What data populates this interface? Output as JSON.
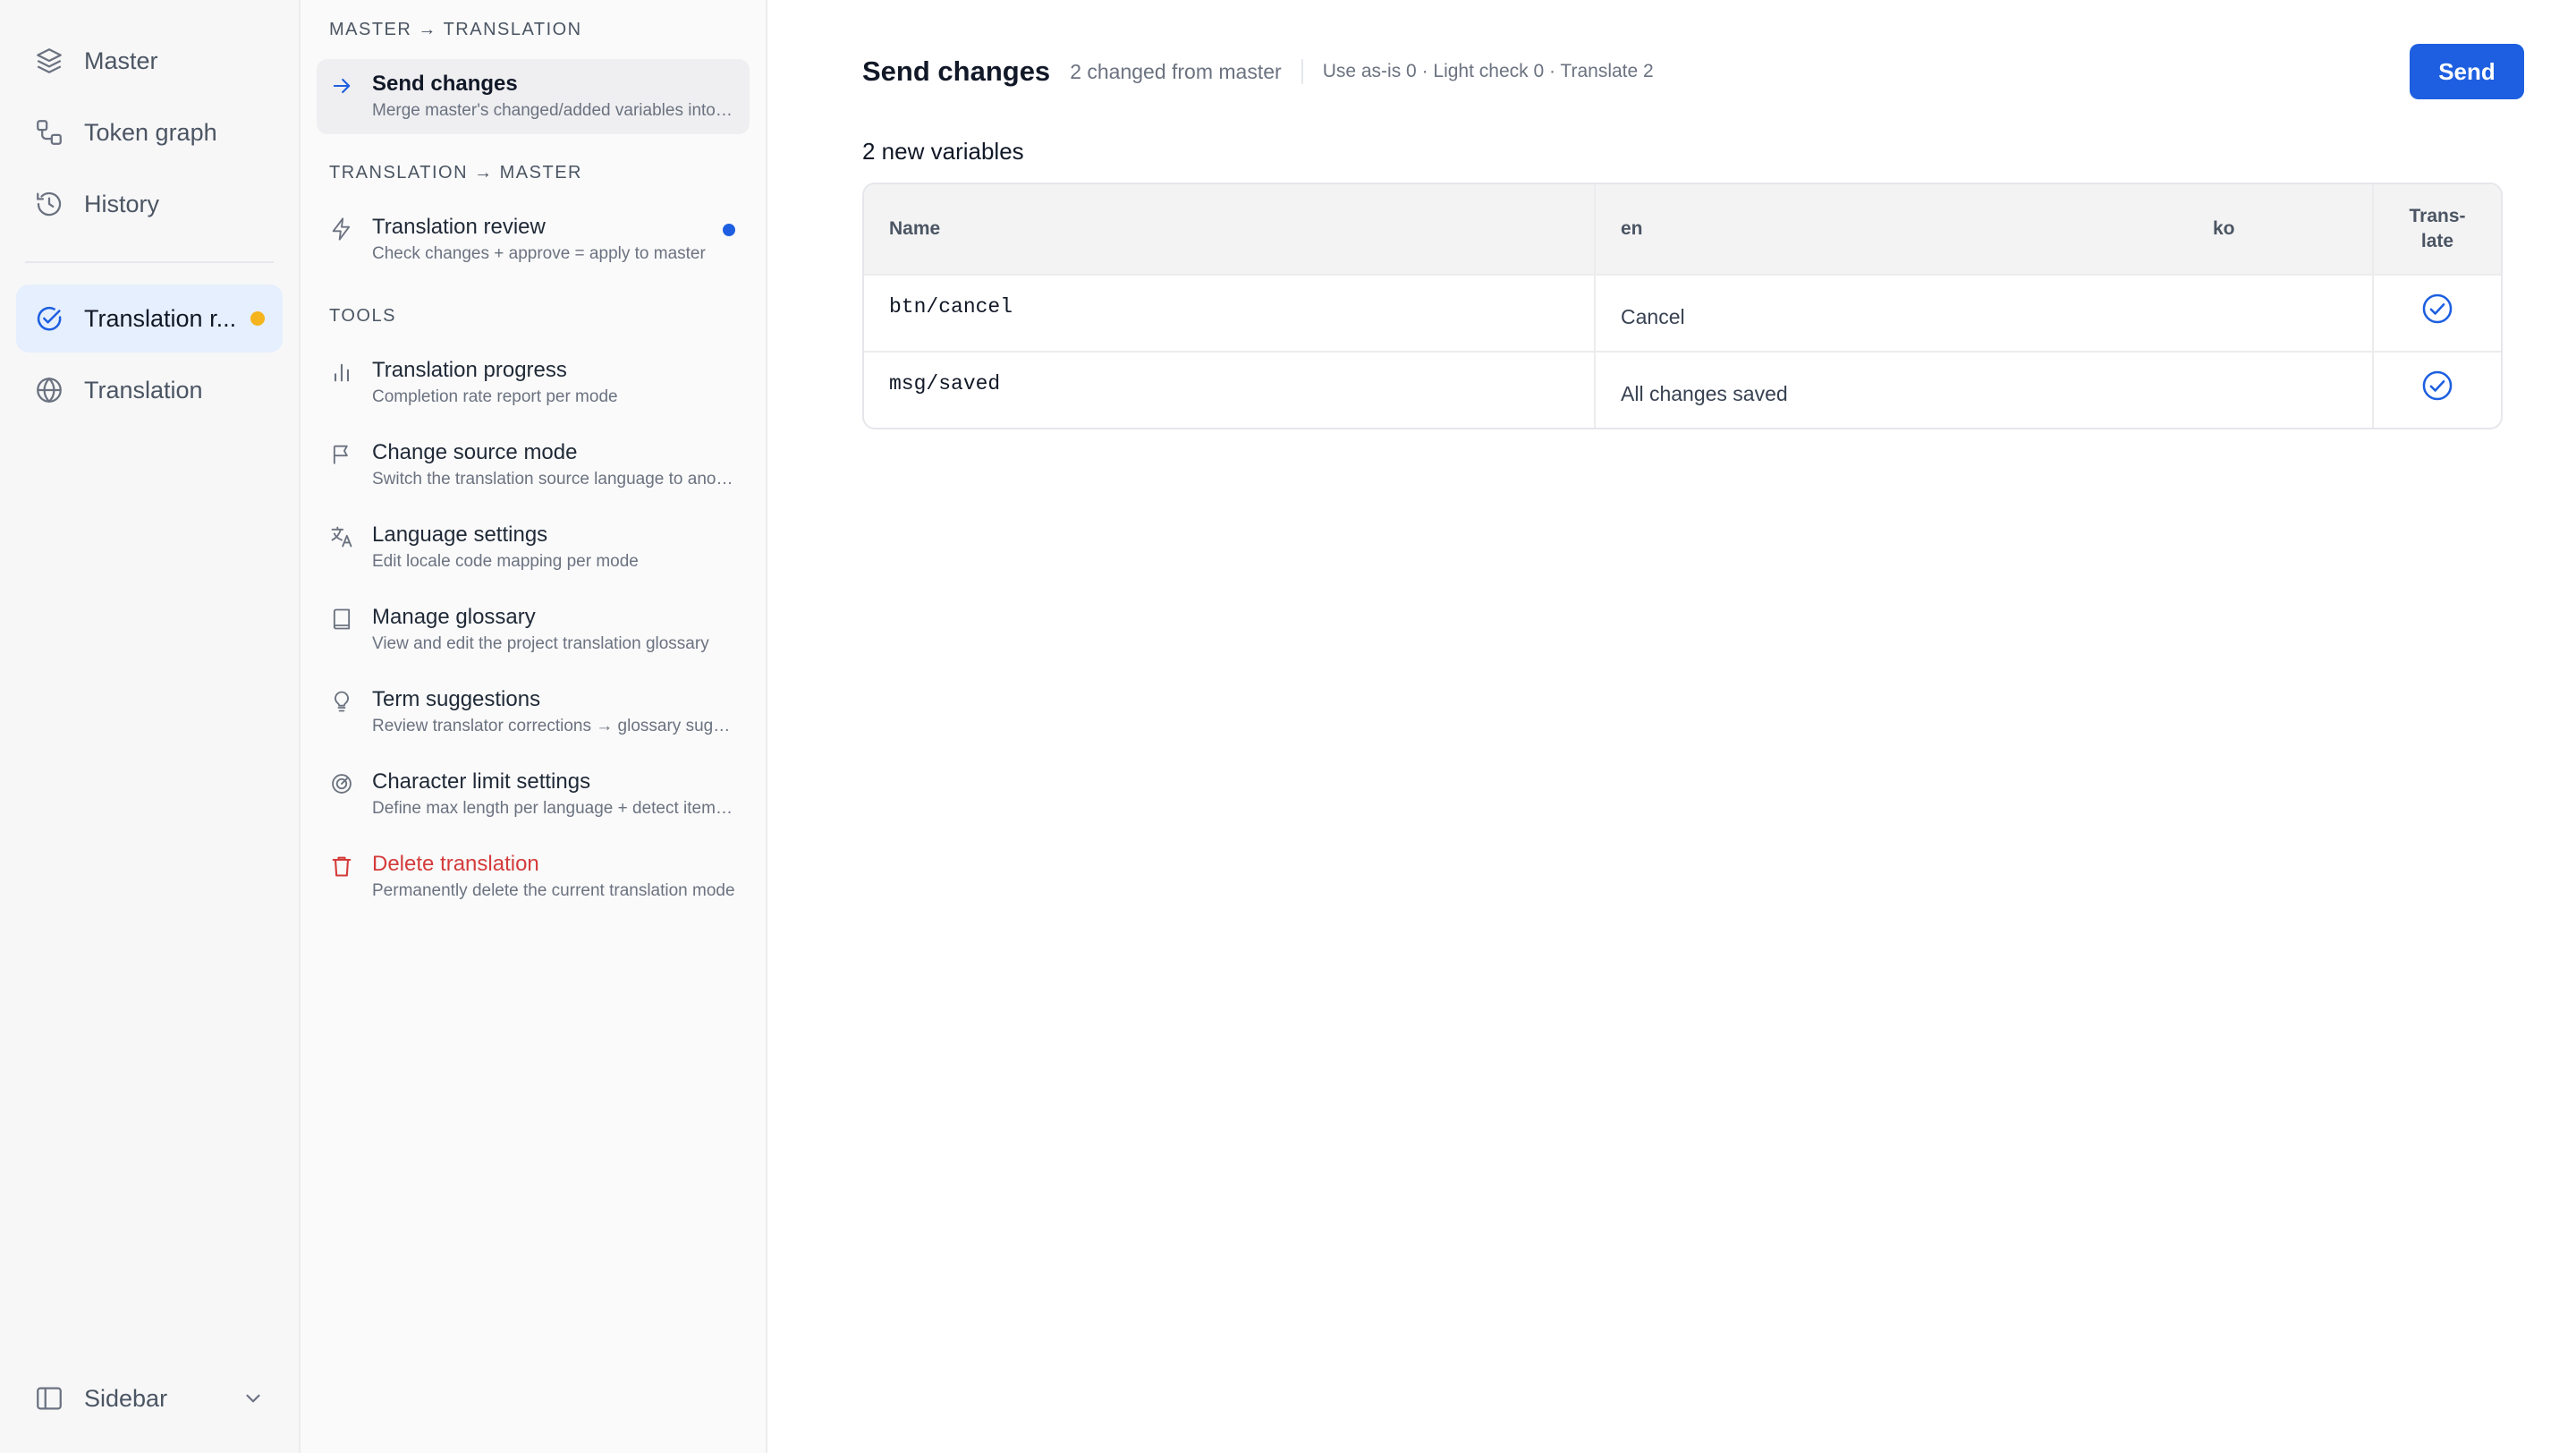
{
  "nav": {
    "items": [
      {
        "label": "Master",
        "icon": "layers-icon"
      },
      {
        "label": "Token graph",
        "icon": "token-graph-icon"
      },
      {
        "label": "History",
        "icon": "history-icon"
      }
    ],
    "secondary": [
      {
        "label": "Translation r...",
        "icon": "check-circle-icon",
        "active": true,
        "badge_color": "#f5b31c"
      },
      {
        "label": "Translation",
        "icon": "globe-icon"
      }
    ],
    "footer": {
      "label": "Sidebar",
      "icon": "sidebar-icon"
    }
  },
  "panel": {
    "sections": {
      "master_to_translation": "MASTER → TRANSLATION",
      "translation_to_master": "TRANSLATION → MASTER",
      "tools": "TOOLS"
    },
    "send_changes": {
      "title": "Send changes",
      "desc": "Merge master's changed/added variables into translation"
    },
    "translation_review": {
      "title": "Translation review",
      "desc": "Check changes + approve = apply to master"
    },
    "tools": [
      {
        "title": "Translation progress",
        "desc": "Completion rate report per mode",
        "icon": "bar-chart-icon"
      },
      {
        "title": "Change source mode",
        "desc": "Switch the translation source language to another mode",
        "icon": "flag-icon"
      },
      {
        "title": "Language settings",
        "desc": "Edit locale code mapping per mode",
        "icon": "translate-icon"
      },
      {
        "title": "Manage glossary",
        "desc": "View and edit the project translation glossary",
        "icon": "book-icon"
      },
      {
        "title": "Term suggestions",
        "desc": "Review translator corrections → glossary suggestions",
        "icon": "lightbulb-icon"
      },
      {
        "title": "Character limit settings",
        "desc": "Define max length per language + detect items over the limit",
        "icon": "gauge-icon"
      }
    ],
    "delete": {
      "title": "Delete translation",
      "desc": "Permanently delete the current translation mode"
    }
  },
  "main": {
    "title": "Send changes",
    "subtitle": "2 changed from master",
    "stats": "Use as-is 0 · Light check 0 · Translate 2",
    "send_label": "Send",
    "count_label": "2 new variables",
    "table": {
      "headers": {
        "name": "Name",
        "en": "en",
        "ko": "ko",
        "translate_line1": "Trans-",
        "translate_line2": "late"
      },
      "rows": [
        {
          "name": "btn/cancel",
          "en": "Cancel",
          "ko": "",
          "translate": true
        },
        {
          "name": "msg/saved",
          "en": "All changes saved",
          "ko": "",
          "translate": true
        }
      ]
    }
  },
  "colors": {
    "accent": "#1d5fe0",
    "danger": "#d43b3b",
    "badge_amber": "#f5b31c"
  }
}
